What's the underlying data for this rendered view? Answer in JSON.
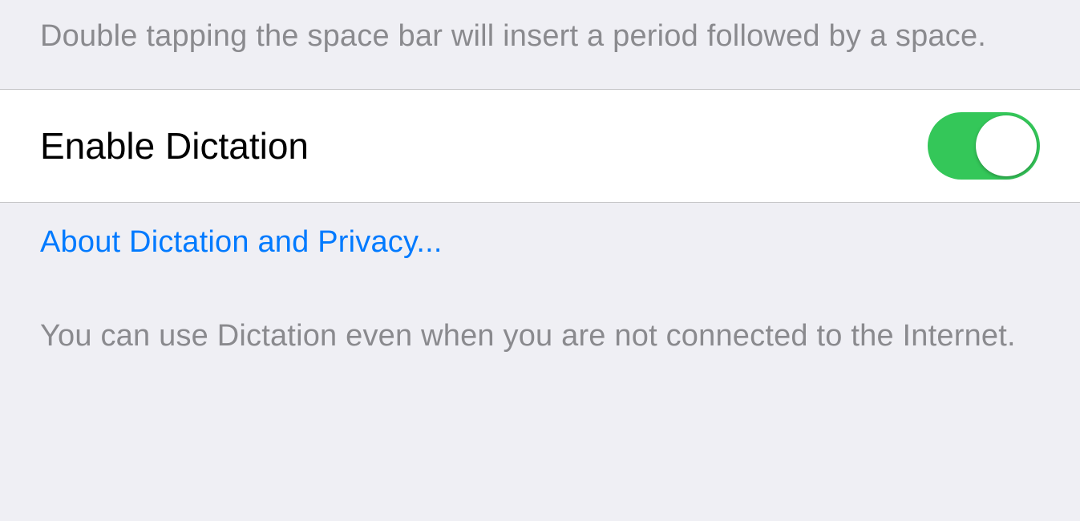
{
  "sections": {
    "prev_footer": "Double tapping the space bar will insert a period followed by a space.",
    "dictation": {
      "label": "Enable Dictation",
      "enabled": true,
      "privacy_link": "About Dictation and Privacy...",
      "info": "You can use Dictation even when you are not connected to the Internet."
    }
  },
  "colors": {
    "background": "#efeff4",
    "cell_bg": "#ffffff",
    "separator": "#c6c6c8",
    "text_primary": "#000000",
    "text_secondary": "#8a8a8e",
    "link": "#007aff",
    "switch_on": "#34c759"
  }
}
